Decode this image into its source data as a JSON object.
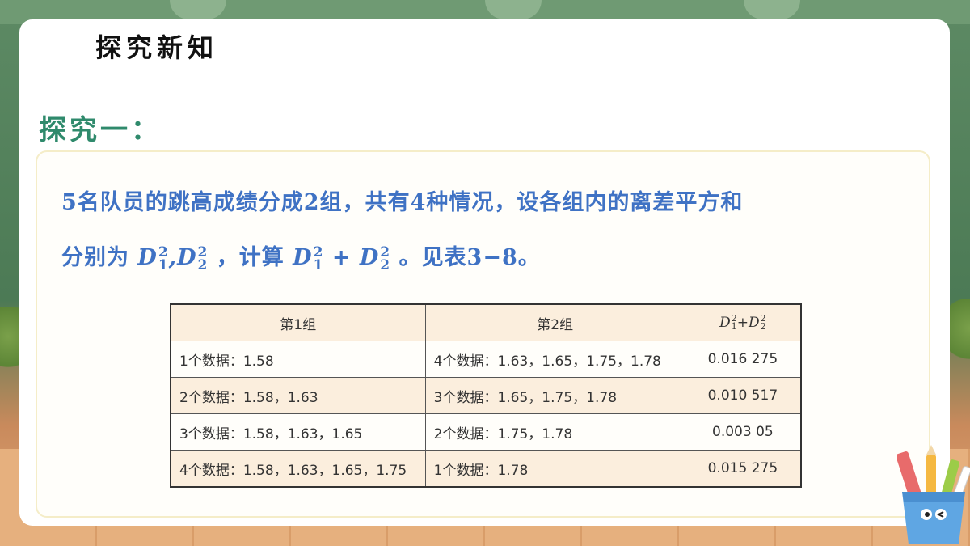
{
  "header": {
    "title": "探究新知"
  },
  "section": {
    "title": "探究一："
  },
  "problem": {
    "line1": "5名队员的跳高成绩分成2组，共有4种情况，设各组内的离差平方和",
    "line2_prefix": "分别为 ",
    "line2_mid": "，计算 ",
    "line2_suffix": " 。见表3−8。",
    "symbol_D": "D",
    "sub1": "1",
    "sub2": "2",
    "sup": "2",
    "comma": ",",
    "plus": " + "
  },
  "table": {
    "headers": [
      "第1组",
      "第2组",
      "D"
    ],
    "header3_sup": "2",
    "header3_sub1": "1",
    "header3_sub2": "2",
    "header3_plus": "+",
    "rows": [
      [
        "1个数据：1.58",
        "4个数据：1.63，1.65，1.75，1.78",
        "0.016 275"
      ],
      [
        "2个数据：1.58，1.63",
        "3个数据：1.65，1.75，1.78",
        "0.010 517"
      ],
      [
        "3个数据：1.58，1.63，1.65",
        "2个数据：1.75，1.78",
        "0.003 05"
      ],
      [
        "4个数据：1.58，1.63，1.65，1.75",
        "1个数据：1.78",
        "0.015 275"
      ]
    ]
  },
  "colors": {
    "section_green": "#2f8a6c",
    "text_blue": "#3f72c4",
    "table_shade": "#fbeedd"
  }
}
